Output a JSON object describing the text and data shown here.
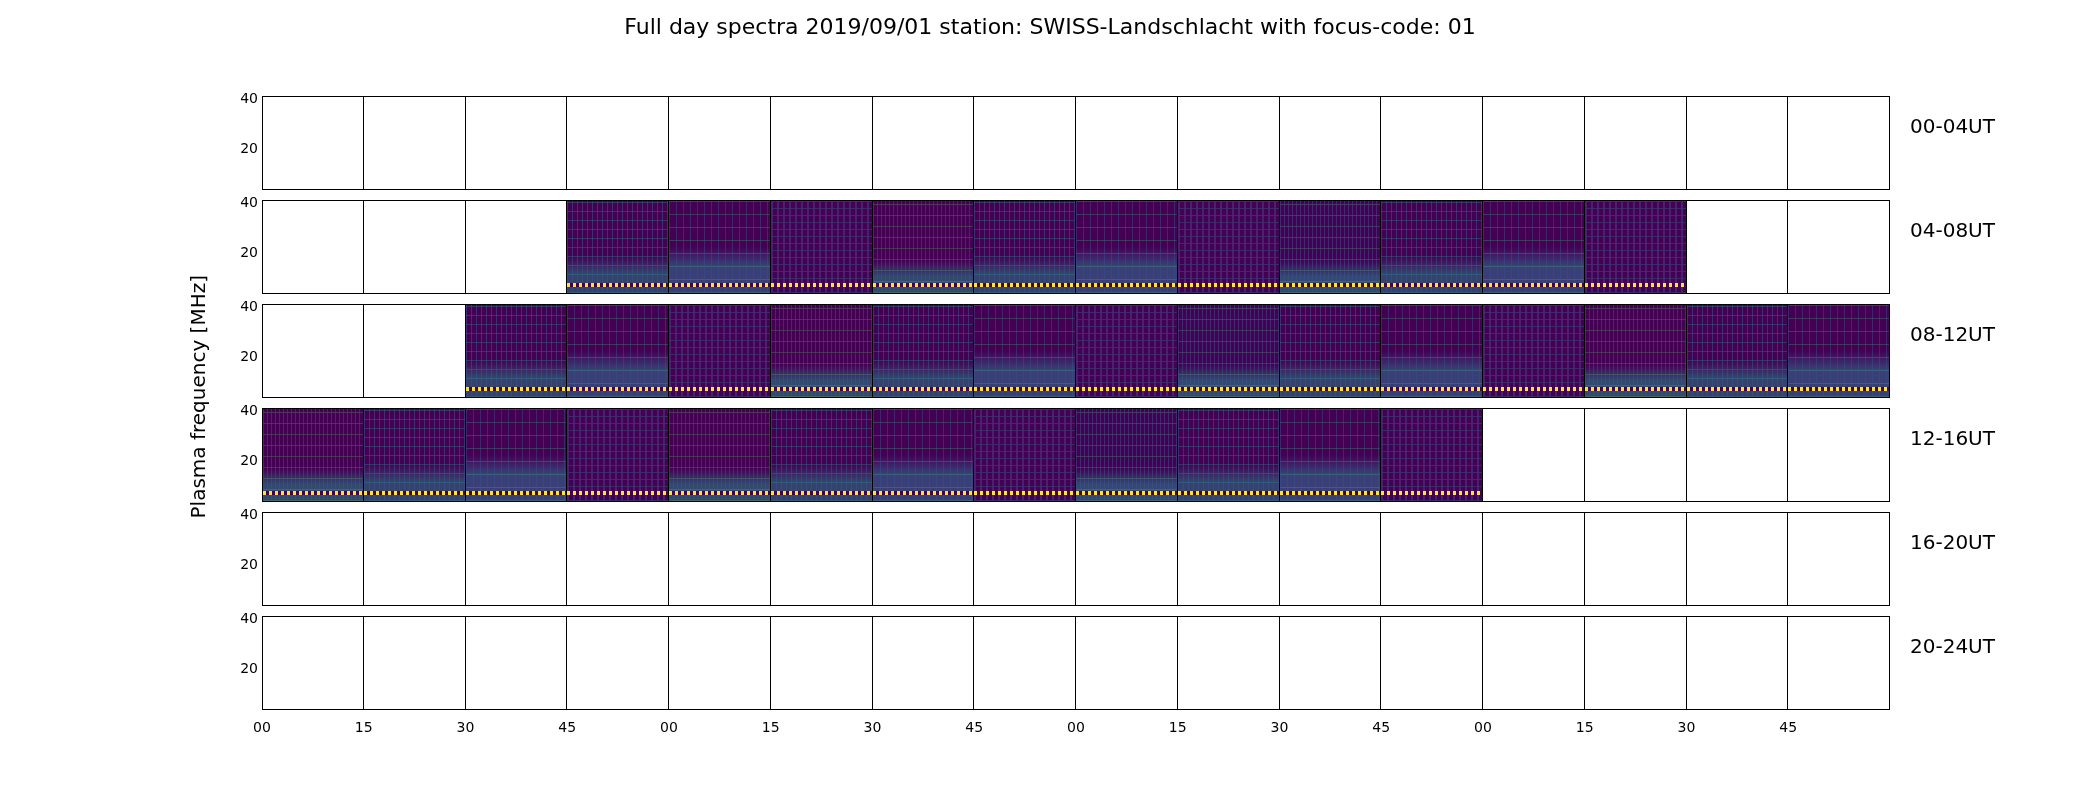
{
  "title": "Full day spectra 2019/09/01 station: SWISS-Landschlacht with focus-code: 01",
  "ylabel": "Plasma frequency [MHz]",
  "rows": [
    {
      "label": "00-04UT",
      "yticks": [
        "40",
        "20"
      ],
      "panels": [
        {
          "has_data": false
        },
        {
          "has_data": false
        },
        {
          "has_data": false
        },
        {
          "has_data": false
        },
        {
          "has_data": false
        },
        {
          "has_data": false
        },
        {
          "has_data": false
        },
        {
          "has_data": false
        },
        {
          "has_data": false
        },
        {
          "has_data": false
        },
        {
          "has_data": false
        },
        {
          "has_data": false
        },
        {
          "has_data": false
        },
        {
          "has_data": false
        },
        {
          "has_data": false
        },
        {
          "has_data": false
        }
      ]
    },
    {
      "label": "04-08UT",
      "yticks": [
        "40",
        "20"
      ],
      "panels": [
        {
          "has_data": false
        },
        {
          "has_data": false
        },
        {
          "has_data": false
        },
        {
          "has_data": true
        },
        {
          "has_data": true
        },
        {
          "has_data": true
        },
        {
          "has_data": true
        },
        {
          "has_data": true
        },
        {
          "has_data": true
        },
        {
          "has_data": true
        },
        {
          "has_data": true
        },
        {
          "has_data": true
        },
        {
          "has_data": true
        },
        {
          "has_data": true
        },
        {
          "has_data": false
        },
        {
          "has_data": false
        }
      ]
    },
    {
      "label": "08-12UT",
      "yticks": [
        "40",
        "20"
      ],
      "panels": [
        {
          "has_data": false
        },
        {
          "has_data": false
        },
        {
          "has_data": true
        },
        {
          "has_data": true
        },
        {
          "has_data": true
        },
        {
          "has_data": true
        },
        {
          "has_data": true
        },
        {
          "has_data": true
        },
        {
          "has_data": true
        },
        {
          "has_data": true
        },
        {
          "has_data": true
        },
        {
          "has_data": true
        },
        {
          "has_data": true
        },
        {
          "has_data": true
        },
        {
          "has_data": true
        },
        {
          "has_data": true
        }
      ]
    },
    {
      "label": "12-16UT",
      "yticks": [
        "40",
        "20"
      ],
      "panels": [
        {
          "has_data": true
        },
        {
          "has_data": true
        },
        {
          "has_data": true
        },
        {
          "has_data": true
        },
        {
          "has_data": true
        },
        {
          "has_data": true
        },
        {
          "has_data": true
        },
        {
          "has_data": true
        },
        {
          "has_data": true
        },
        {
          "has_data": true
        },
        {
          "has_data": true
        },
        {
          "has_data": true
        },
        {
          "has_data": false
        },
        {
          "has_data": false
        },
        {
          "has_data": false
        },
        {
          "has_data": false
        }
      ]
    },
    {
      "label": "16-20UT",
      "yticks": [
        "40",
        "20"
      ],
      "panels": [
        {
          "has_data": false
        },
        {
          "has_data": false
        },
        {
          "has_data": false
        },
        {
          "has_data": false
        },
        {
          "has_data": false
        },
        {
          "has_data": false
        },
        {
          "has_data": false
        },
        {
          "has_data": false
        },
        {
          "has_data": false
        },
        {
          "has_data": false
        },
        {
          "has_data": false
        },
        {
          "has_data": false
        },
        {
          "has_data": false
        },
        {
          "has_data": false
        },
        {
          "has_data": false
        },
        {
          "has_data": false
        }
      ]
    },
    {
      "label": "20-24UT",
      "yticks": [
        "40",
        "20"
      ],
      "panels": [
        {
          "has_data": false
        },
        {
          "has_data": false
        },
        {
          "has_data": false
        },
        {
          "has_data": false
        },
        {
          "has_data": false
        },
        {
          "has_data": false
        },
        {
          "has_data": false
        },
        {
          "has_data": false
        },
        {
          "has_data": false
        },
        {
          "has_data": false
        },
        {
          "has_data": false
        },
        {
          "has_data": false
        },
        {
          "has_data": false
        },
        {
          "has_data": false
        },
        {
          "has_data": false
        },
        {
          "has_data": false
        }
      ]
    }
  ],
  "xticks": [
    "00",
    "15",
    "30",
    "45",
    "00",
    "15",
    "30",
    "45",
    "00",
    "15",
    "30",
    "45",
    "00",
    "15",
    "30",
    "45"
  ]
}
